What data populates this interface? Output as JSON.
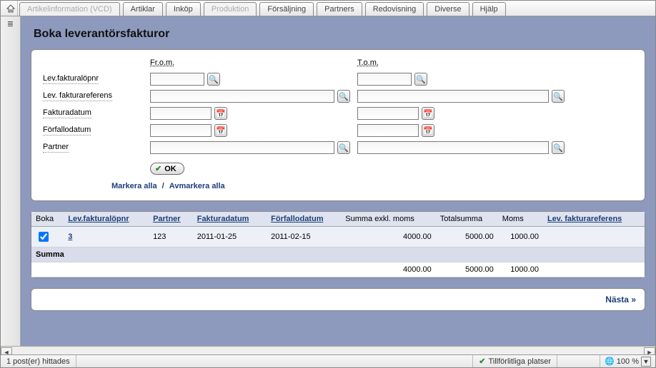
{
  "topbar": {
    "tabs": [
      {
        "label": "Artikelinformation (VCD)",
        "disabled": true
      },
      {
        "label": "Artiklar",
        "disabled": false
      },
      {
        "label": "Inköp",
        "disabled": false
      },
      {
        "label": "Produktion",
        "disabled": true
      },
      {
        "label": "Försäljning",
        "disabled": false
      },
      {
        "label": "Partners",
        "disabled": false
      },
      {
        "label": "Redovisning",
        "disabled": false
      },
      {
        "label": "Diverse",
        "disabled": false
      },
      {
        "label": "Hjälp",
        "disabled": false
      }
    ]
  },
  "page": {
    "title": "Boka leverantörsfakturor"
  },
  "form": {
    "col_from": "Fr.o.m.",
    "col_to": "T.o.m.",
    "labels": {
      "lopnr": "Lev.fakturalöpnr",
      "ref": "Lev. fakturareferens",
      "fdatum": "Fakturadatum",
      "forfallo": "Förfallodatum",
      "partner": "Partner"
    },
    "ok": "OK",
    "mark_all": "Markera alla",
    "unmark_all": "Avmarkera alla"
  },
  "grid": {
    "headers": {
      "boka": "Boka",
      "lopnr": "Lev.fakturalöpnr",
      "partner": "Partner",
      "fdatum": "Fakturadatum",
      "forfallo": "Förfallodatum",
      "sumexkl": "Summa exkl. moms",
      "totsum": "Totalsumma",
      "moms": "Moms",
      "ref": "Lev. fakturareferens"
    },
    "rows": [
      {
        "checked": true,
        "lopnr": "3",
        "partner": "123",
        "fdatum": "2011-01-25",
        "forfallo": "2011-02-15",
        "sumexkl": "4000.00",
        "totsum": "5000.00",
        "moms": "1000.00",
        "ref": ""
      }
    ],
    "sumlabel": "Summa",
    "sum": {
      "sumexkl": "4000.00",
      "totsum": "5000.00",
      "moms": "1000.00"
    }
  },
  "next": "Nästa »",
  "status": {
    "posts": "1 post(er) hittades",
    "trusted": "Tillförlitliga platser",
    "zoom": "100 %"
  },
  "icons": {
    "search": "🔍",
    "calendar": "📅",
    "globe": "🌐"
  }
}
